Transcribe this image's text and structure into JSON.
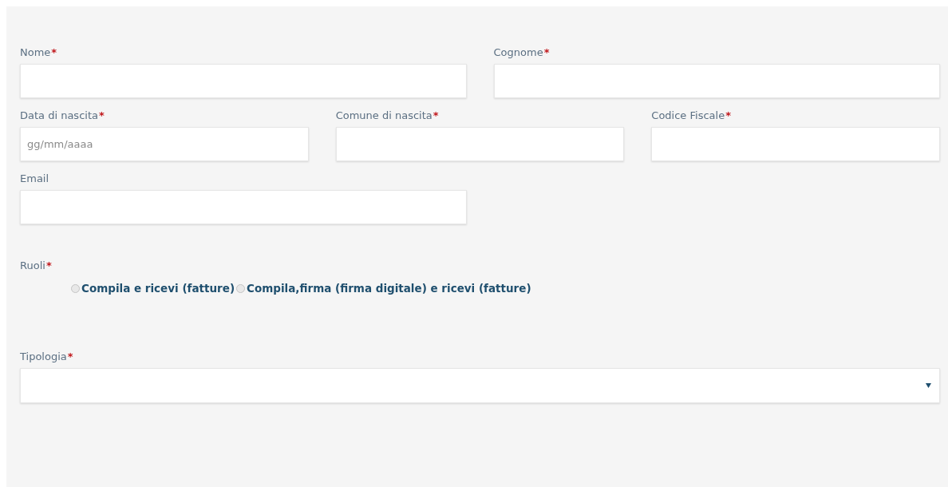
{
  "rows": [
    [
      {
        "label": "Nome",
        "required_mark": "*"
      },
      {
        "label": "Cognome",
        "required_mark": "*"
      }
    ],
    [
      {
        "label": "Data di nascita",
        "required_mark": "*",
        "placeholder": "gg/mm/aaaa"
      },
      {
        "label": "Comune di nascita",
        "required_mark": "*"
      },
      {
        "label": "Codice Fiscale",
        "required_mark": "*"
      }
    ],
    [
      {
        "label": "Email"
      }
    ]
  ],
  "roles": {
    "label": "Ruoli",
    "required_mark": "*",
    "options": [
      {
        "label": "Compila e ricevi (fatture)",
        "selected": false
      },
      {
        "label": "Compila,firma (firma digitale) e ricevi (fatture)",
        "selected": false
      }
    ]
  },
  "type_select": {
    "label": "Tipologia",
    "required_mark": "*"
  }
}
